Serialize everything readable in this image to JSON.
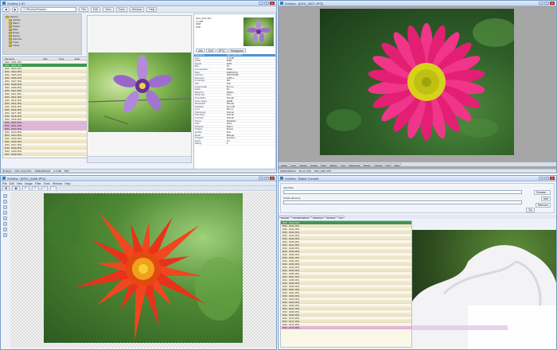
{
  "top_left": {
    "title": "XnView 1.97",
    "address": "C:\\Photos\\Flowers",
    "menu_items": [
      "File",
      "Edit",
      "View",
      "Tools",
      "Window",
      "Help"
    ],
    "folder_tree": [
      "Flowers",
      "Garden",
      "Macro",
      "Nature",
      "Park",
      "Roses",
      "Spring",
      "Summer",
      "Trees",
      "Travel"
    ],
    "file_list": {
      "columns": [
        "Filename",
        "Size",
        "Type",
        "Date"
      ],
      "rows": [
        "DSC_0101.JPG",
        "DSC_0102.JPG",
        "DSC_0103.JPG",
        "DSC_0104.JPG",
        "DSC_0105.JPG",
        "DSC_0106.JPG",
        "DSC_0107.JPG",
        "DSC_0108.JPG",
        "DSC_0109.JPG",
        "DSC_0110.JPG",
        "DSC_0111.JPG",
        "DSC_0112.JPG",
        "DSC_0113.JPG",
        "DSC_0114.JPG",
        "DSC_0115.JPG",
        "DSC_0116.JPG",
        "DSC_0117.JPG",
        "DSC_0118.JPG",
        "DSC_0119.JPG",
        "DSC_0120.JPG",
        "DSC_0121.JPG",
        "DSC_0122.JPG",
        "DSC_0123.JPG",
        "DSC_0124.JPG",
        "DSC_0125.JPG",
        "DSC_0126.JPG",
        "DSC_0127.JPG",
        "DSC_0128.JPG",
        "DSC_0129.JPG",
        "DSC_0130.JPG"
      ]
    },
    "info_panel": {
      "tabs": [
        "Info",
        "Exif",
        "IPTC",
        "Histogram"
      ],
      "properties": [
        [
          "Filename",
          "DSC_0114.JPG"
        ],
        [
          "Size",
          "2.4 MB"
        ],
        [
          "Width",
          "3008"
        ],
        [
          "Height",
          "2000"
        ],
        [
          "Bits",
          "24"
        ],
        [
          "Compression",
          "JPEG"
        ],
        [
          "Date",
          "2008-05-14"
        ],
        [
          "Camera",
          "NIKON D80"
        ],
        [
          "Exposure",
          "1/250 s"
        ],
        [
          "F-Number",
          "F/8"
        ],
        [
          "ISO",
          "100"
        ],
        [
          "Focal length",
          "60 mm"
        ],
        [
          "Flash",
          "No"
        ],
        [
          "Metering",
          "Pattern"
        ],
        [
          "White bal.",
          "Auto"
        ],
        [
          "Orientation",
          "Normal"
        ],
        [
          "Color space",
          "sRGB"
        ],
        [
          "Resolution",
          "300 dpi"
        ],
        [
          "Software",
          "Ver.1.00"
        ],
        [
          "Lens",
          "60 mm"
        ],
        [
          "Sharpness",
          "Normal"
        ],
        [
          "Saturation",
          "Normal"
        ],
        [
          "Contrast",
          "Normal"
        ],
        [
          "Scene",
          "Standard"
        ],
        [
          "Gain",
          "None"
        ],
        [
          "Distance",
          "Macro"
        ],
        [
          "Subject",
          "Flower"
        ],
        [
          "Quality",
          "Fine"
        ],
        [
          "Mode",
          "Manual"
        ],
        [
          "Program",
          "Aperture"
        ],
        [
          "Zoom",
          "1.0"
        ],
        [
          "Rating",
          "5"
        ]
      ]
    },
    "status": [
      "30 file(s)",
      "DSC_0114.JPG",
      "3008x2000x24",
      "2.4 MB",
      "50%"
    ]
  },
  "top_right": {
    "title": "XnView - [DSC_0207.JPG]",
    "bottom_tabs": [
      "Adjust",
      "Crop",
      "Resize",
      "Rotate",
      "Filter",
      "Effects",
      "Text",
      "Watermark",
      "Border",
      "Canvas",
      "Print",
      "Save"
    ],
    "status": [
      "3008x2000x24",
      "Zoom: 33%",
      "DSC_0207.JPG"
    ]
  },
  "bottom_left": {
    "title": "XnView - [DSC_0188.JPG]",
    "menu_items": [
      "File",
      "Edit",
      "View",
      "Image",
      "Filter",
      "Tools",
      "Window",
      "Help"
    ]
  },
  "bottom_right": {
    "title": "XnView - Batch Convert",
    "input_label": "Input files",
    "output_label": "Output directory",
    "browse_button": "Browse...",
    "add_button": "Add",
    "remove_button": "Remove",
    "go_button": "Go",
    "tabs": [
      "General",
      "Transformations",
      "Advanced",
      "Rename",
      "Log"
    ],
    "file_rows": [
      "DSC_0140.JPG",
      "DSC_0141.JPG",
      "DSC_0142.JPG",
      "DSC_0143.JPG",
      "DSC_0144.JPG",
      "DSC_0145.JPG",
      "DSC_0146.JPG",
      "DSC_0147.JPG",
      "DSC_0148.JPG",
      "DSC_0149.JPG",
      "DSC_0150.JPG",
      "DSC_0151.JPG",
      "DSC_0152.JPG",
      "DSC_0153.JPG",
      "DSC_0154.JPG",
      "DSC_0155.JPG",
      "DSC_0156.JPG",
      "DSC_0157.JPG",
      "DSC_0158.JPG",
      "DSC_0159.JPG",
      "DSC_0160.JPG",
      "DSC_0161.JPG",
      "DSC_0162.JPG",
      "DSC_0163.JPG",
      "DSC_0164.JPG",
      "DSC_0165.JPG",
      "DSC_0166.JPG",
      "DSC_0167.JPG",
      "DSC_0168.JPG",
      "DSC_0169.JPG",
      "DSC_0170.JPG",
      "DSC_0171.JPG",
      "DSC_0172.JPG",
      "DSC_0173.JPG"
    ]
  },
  "colors": {
    "window_border": "#7a9cc6",
    "selection_green": "#3c9a4f",
    "info_highlight": "#4e93d8",
    "row_alt": "#efe6c8",
    "row_pink": "#e2b8d8"
  }
}
